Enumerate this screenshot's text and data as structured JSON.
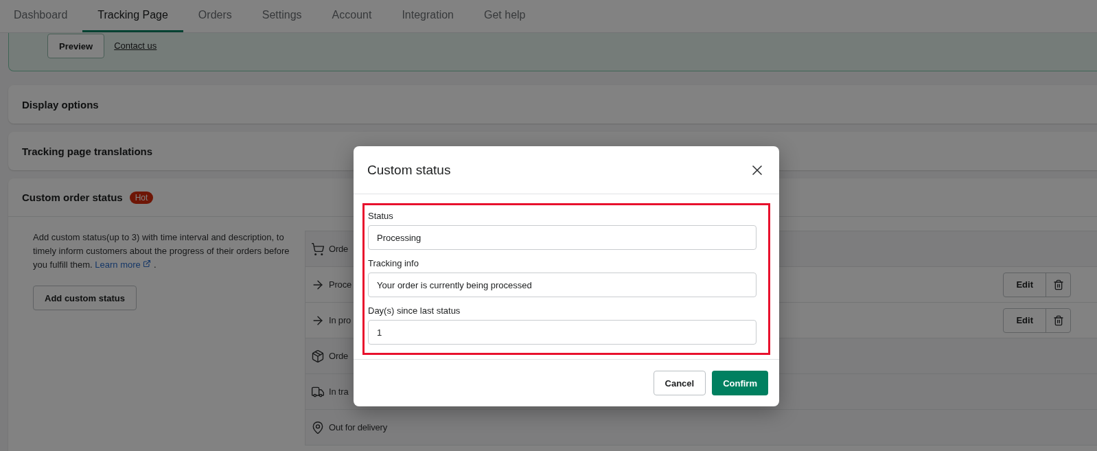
{
  "nav": {
    "tabs": [
      {
        "label": "Dashboard",
        "selected": false
      },
      {
        "label": "Tracking Page",
        "selected": true
      },
      {
        "label": "Orders",
        "selected": false
      },
      {
        "label": "Settings",
        "selected": false
      },
      {
        "label": "Account",
        "selected": false
      },
      {
        "label": "Integration",
        "selected": false
      },
      {
        "label": "Get help",
        "selected": false
      }
    ]
  },
  "banner": {
    "preview_button": "Preview",
    "contact_link": "Contact us"
  },
  "sections": [
    {
      "title": "Display options"
    },
    {
      "title": "Tracking page translations"
    }
  ],
  "custom_order_status": {
    "title": "Custom order status",
    "badge": "Hot",
    "description": "Add custom status(up to 3) with time interval and description, to timely inform customers about the progress of their orders before you fulfill them.",
    "learn_more": "Learn more",
    "after_link": ".",
    "add_button": "Add custom status",
    "statuses": [
      {
        "kind": "ordered",
        "label": "Orde"
      },
      {
        "kind": "custom",
        "label": "Proce",
        "edit": "Edit"
      },
      {
        "kind": "custom",
        "label": "In pro",
        "edit": "Edit"
      },
      {
        "kind": "fulfilled",
        "label": "Orde"
      },
      {
        "kind": "transit",
        "label": "In tra"
      },
      {
        "kind": "delivery",
        "label": "Out for delivery"
      }
    ]
  },
  "modal": {
    "title": "Custom status",
    "fields": [
      {
        "label": "Status",
        "value": "Processing"
      },
      {
        "label": "Tracking info",
        "value": "Your order is currently being processed"
      },
      {
        "label": "Day(s) since last status",
        "value": "1"
      }
    ],
    "cancel": "Cancel",
    "confirm": "Confirm"
  }
}
